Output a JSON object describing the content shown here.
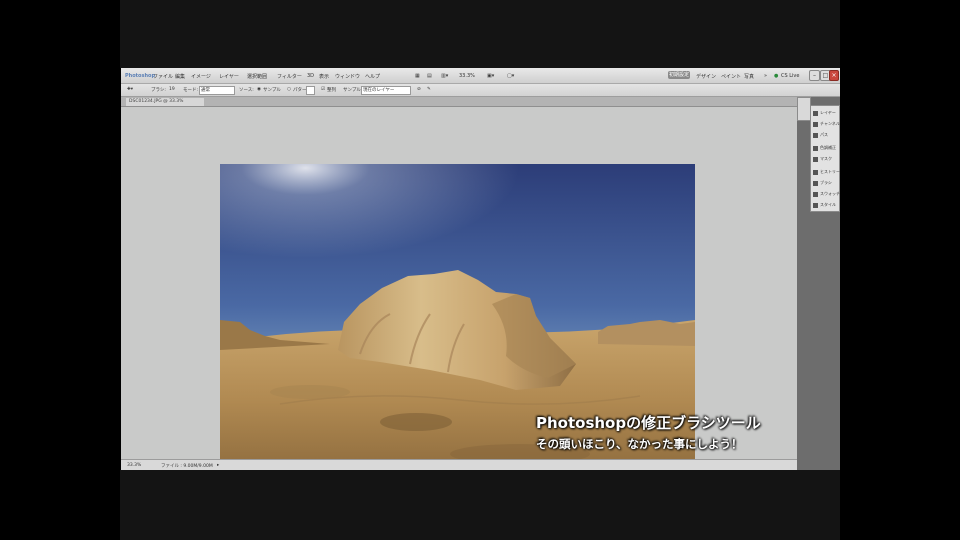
{
  "app": {
    "menu": [
      "Photoshop",
      "ファイル",
      "編集",
      "イメージ",
      "レイヤー",
      "選択範囲",
      "フィルター",
      "3D",
      "表示",
      "ウィンドウ",
      "ヘルプ"
    ],
    "workspace_buttons": [
      "初期設定",
      "デザイン",
      "ペイント",
      "写真"
    ],
    "right_link": "CS Live",
    "window_controls": [
      "–",
      "□",
      "×"
    ]
  },
  "options_bar": {
    "items": [
      "ブラシ:",
      "19",
      "モード:",
      "通常",
      "ソース:",
      "サンプル",
      "パターン",
      "整列",
      "サンプル:",
      "現在のレイヤー"
    ]
  },
  "document": {
    "tab_label": "DSC01234.JPG @ 33.3%",
    "zoom": "33.3%",
    "status_info": "ファイル : 9.00M/9.00M"
  },
  "panels": {
    "items": [
      "レイヤー",
      "チャンネル",
      "パス",
      "色調補正",
      "マスク",
      "ヒストリー",
      "ブラシ",
      "スウォッチ",
      "スタイル"
    ]
  },
  "caption": {
    "line1": "Photoshopの修正ブラシツール",
    "line2": "その頭いほこり、なかった事にしよう！"
  },
  "colors": {
    "ui_bg": "#c8c9c8",
    "sky_top": "#2d3f7a",
    "sky_horizon": "#8ab0cf",
    "sand": "#c29a5e",
    "rock": "#d4b47e"
  }
}
